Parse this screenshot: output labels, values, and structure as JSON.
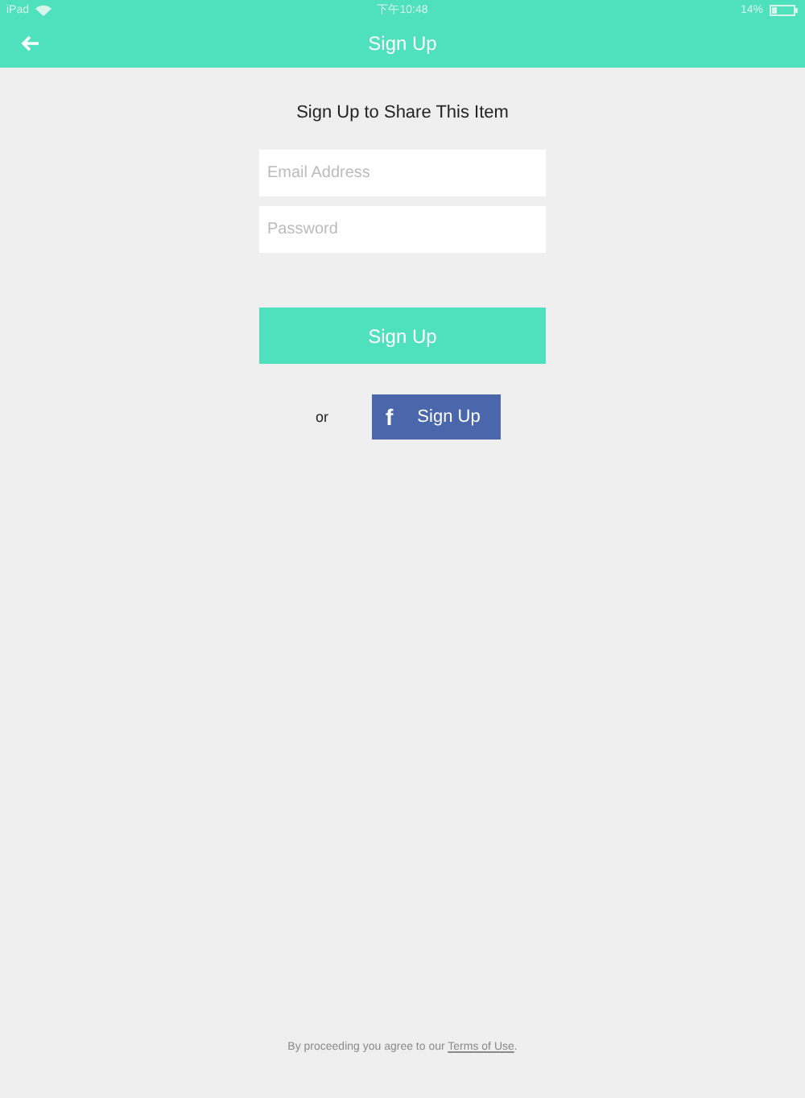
{
  "status_bar": {
    "device": "iPad",
    "time": "下午10:48",
    "battery": "14%"
  },
  "nav_bar": {
    "title": "Sign Up"
  },
  "heading": "Sign Up to Share This Item",
  "fields": [
    {
      "placeholder": "Email Address"
    },
    {
      "placeholder": "Password"
    }
  ],
  "sign_up_button": "Sign Up",
  "separator": "or",
  "facebook_button": {
    "logo": "f",
    "label": "Sign Up"
  },
  "footer": {
    "text": "By proceeding you agree to our",
    "link": "Terms of Use",
    "end": "."
  }
}
